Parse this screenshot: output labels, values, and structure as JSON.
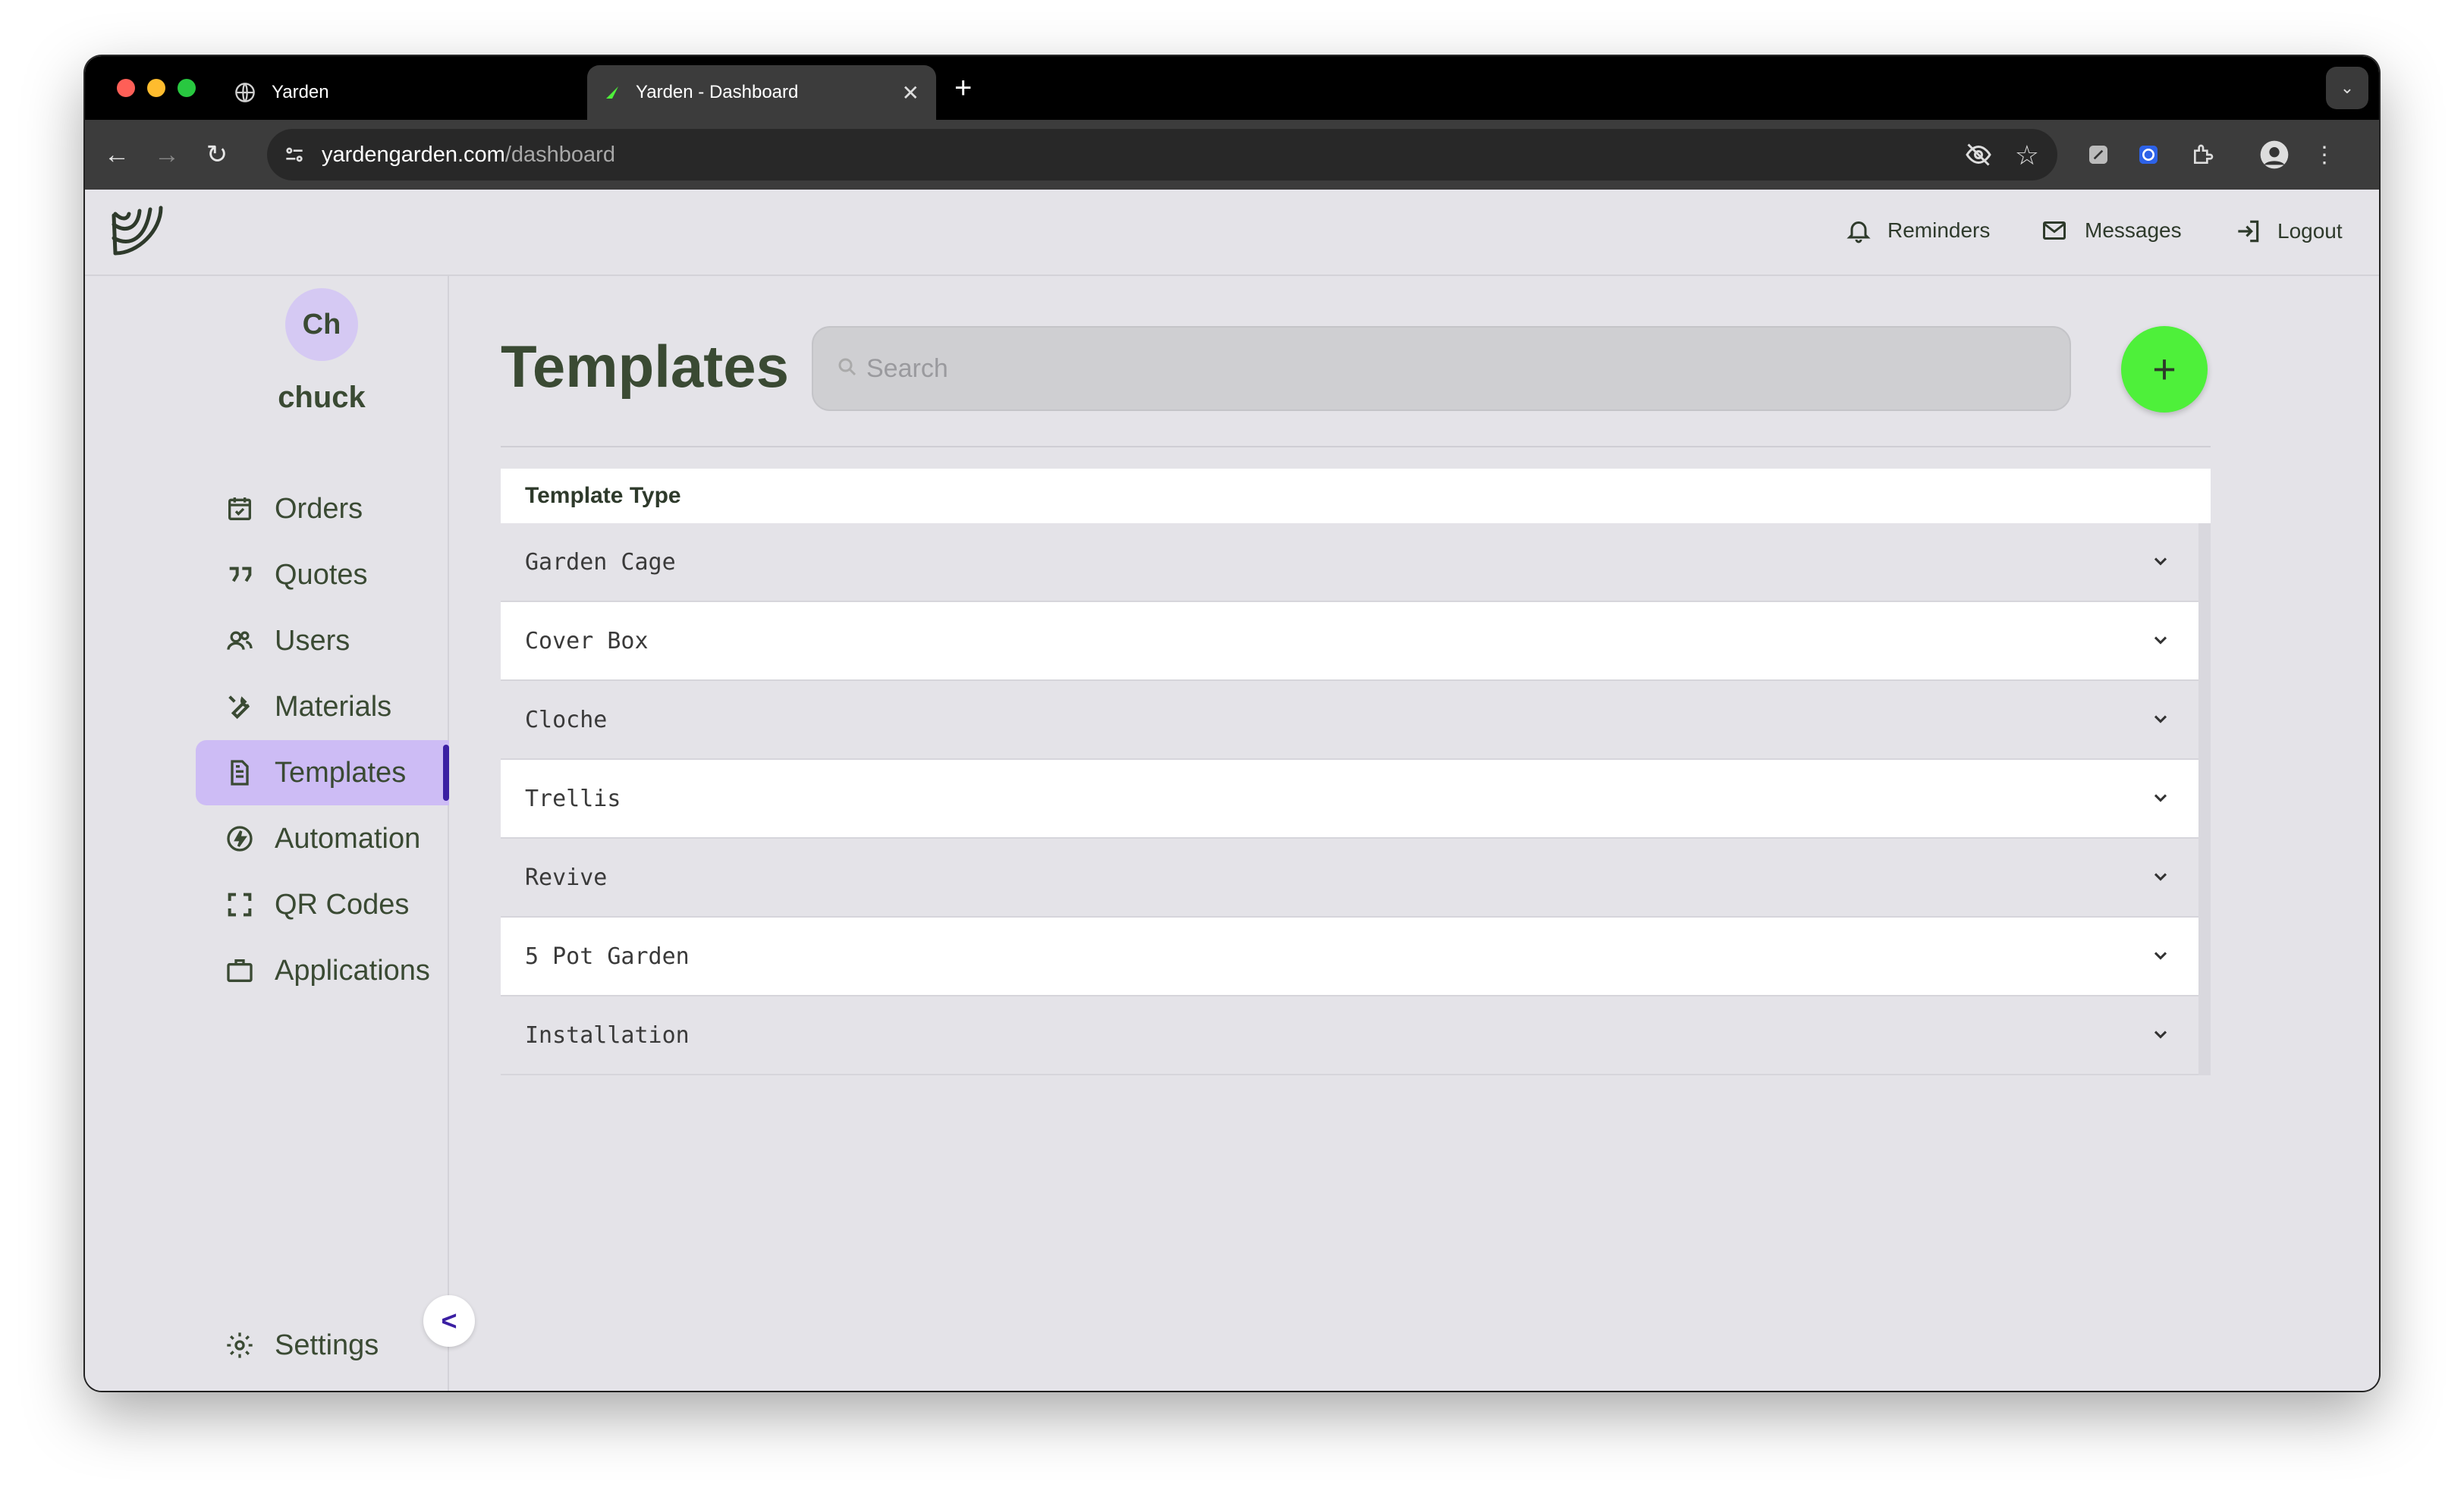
{
  "browser": {
    "tabs": [
      {
        "title": "Yarden",
        "icon": "globe-icon"
      },
      {
        "title": "Yarden - Dashboard",
        "icon": "yarden-favicon-icon"
      }
    ],
    "url_host": "yardengarden.com",
    "url_path": "/dashboard"
  },
  "header": {
    "reminders_label": "Reminders",
    "messages_label": "Messages",
    "logout_label": "Logout"
  },
  "user": {
    "initials": "Ch",
    "name": "chuck"
  },
  "sidebar": {
    "items": [
      {
        "label": "Orders",
        "icon": "calendar-check-icon"
      },
      {
        "label": "Quotes",
        "icon": "quote-icon"
      },
      {
        "label": "Users",
        "icon": "users-icon"
      },
      {
        "label": "Materials",
        "icon": "wrench-icon"
      },
      {
        "label": "Templates",
        "icon": "document-icon",
        "active": true
      },
      {
        "label": "Automation",
        "icon": "lightning-icon"
      },
      {
        "label": "QR Codes",
        "icon": "scan-icon"
      },
      {
        "label": "Applications",
        "icon": "briefcase-icon"
      }
    ],
    "settings_label": "Settings",
    "collapse_label": "<"
  },
  "main": {
    "title": "Templates",
    "search_placeholder": "Search",
    "add_label": "+",
    "table": {
      "header": "Template Type",
      "rows": [
        "Garden Cage",
        "Cover Box",
        "Cloche",
        "Trellis",
        "Revive",
        "5 Pot Garden",
        "Installation"
      ]
    }
  },
  "colors": {
    "accent_green": "#4ef03a",
    "active_nav_bg": "#cdbcf5",
    "active_nav_bar": "#3b1fa3",
    "text_green": "#3a4a33"
  }
}
